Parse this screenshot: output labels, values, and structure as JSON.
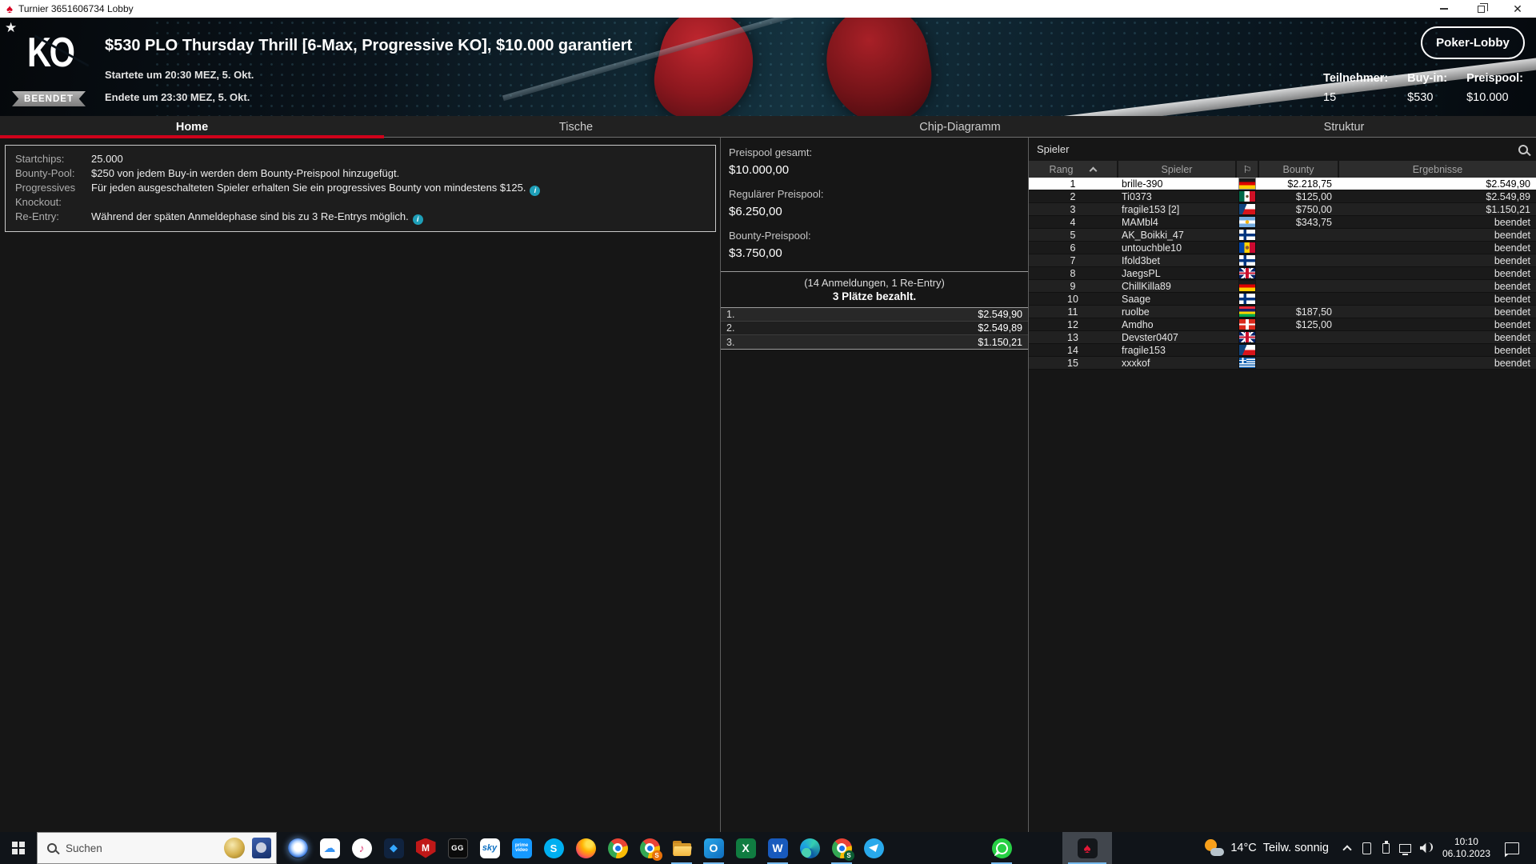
{
  "window": {
    "title": "Turnier 3651606734 Lobby"
  },
  "header": {
    "logo": "KO",
    "status_badge": "BEENDET",
    "title": "$530 PLO Thursday Thrill [6-Max, Progressive KO], $10.000 garantiert",
    "started": "Startete um 20:30 MEZ, 5. Okt.",
    "ended": "Endete um 23:30 MEZ, 5. Okt.",
    "lobby_button": "Poker-Lobby",
    "stats": [
      {
        "label": "Teilnehmer:",
        "value": "15"
      },
      {
        "label": "Buy-in:",
        "value": "$530"
      },
      {
        "label": "Preispool:",
        "value": "$10.000"
      }
    ]
  },
  "tabs": [
    {
      "name": "home",
      "label": "Home",
      "active": true
    },
    {
      "name": "tische",
      "label": "Tische"
    },
    {
      "name": "chip-diagramm",
      "label": "Chip-Diagramm"
    },
    {
      "name": "struktur",
      "label": "Struktur"
    }
  ],
  "info_panel": {
    "rows": [
      {
        "label": "Startchips:",
        "text": "25.000"
      },
      {
        "label": "Bounty-Pool:",
        "text": "$250 von jedem Buy-in werden dem Bounty-Preispool hinzugefügt."
      },
      {
        "label": "Progressives Knockout:",
        "text": "Für jeden ausgeschalteten Spieler erhalten Sie ein progressives Bounty von mindestens $125.",
        "info": true
      },
      {
        "label": "Re-Entry:",
        "text": "Während der späten Anmeldephase sind bis zu 3 Re-Entrys möglich.",
        "info": true
      }
    ]
  },
  "prize_panel": {
    "pools": [
      {
        "label": "Preispool gesamt:",
        "value": "$10.000,00"
      },
      {
        "label": "Regulärer Preispool:",
        "value": "$6.250,00"
      },
      {
        "label": "Bounty-Preispool:",
        "value": "$3.750,00"
      }
    ],
    "entries_note": "(14 Anmeldungen, 1 Re-Entry)",
    "places_paid": "3 Plätze bezahlt.",
    "payouts": [
      {
        "place": "1.",
        "amount": "$2.549,90"
      },
      {
        "place": "2.",
        "amount": "$2.549,89"
      },
      {
        "place": "3.",
        "amount": "$1.150,21"
      }
    ]
  },
  "players_panel": {
    "title": "Spieler",
    "columns": {
      "rank": "Rang",
      "player": "Spieler",
      "bounty": "Bounty",
      "result": "Ergebnisse"
    },
    "rows": [
      {
        "rank": "1",
        "name": "brille-390",
        "flag": "de",
        "bounty": "$2.218,75",
        "result": "$2.549,90",
        "highlight": true
      },
      {
        "rank": "2",
        "name": "Ti0373",
        "flag": "mx",
        "bounty": "$125,00",
        "result": "$2.549,89"
      },
      {
        "rank": "3",
        "name": "fragile153 [2]",
        "flag": "cz",
        "bounty": "$750,00",
        "result": "$1.150,21"
      },
      {
        "rank": "4",
        "name": "MAMbl4",
        "flag": "ar",
        "bounty": "$343,75",
        "result": "beendet"
      },
      {
        "rank": "5",
        "name": "AK_Boikki_47",
        "flag": "fi",
        "bounty": "",
        "result": "beendet"
      },
      {
        "rank": "6",
        "name": "untouchble10",
        "flag": "md",
        "bounty": "",
        "result": "beendet"
      },
      {
        "rank": "7",
        "name": "Ifold3bet",
        "flag": "fi",
        "bounty": "",
        "result": "beendet"
      },
      {
        "rank": "8",
        "name": "JaegsPL",
        "flag": "gb",
        "bounty": "",
        "result": "beendet"
      },
      {
        "rank": "9",
        "name": "ChillKilla89",
        "flag": "de",
        "bounty": "",
        "result": "beendet"
      },
      {
        "rank": "10",
        "name": "Saage",
        "flag": "fi",
        "bounty": "",
        "result": "beendet"
      },
      {
        "rank": "11",
        "name": "ruolbe",
        "flag": "mu",
        "bounty": "$187,50",
        "result": "beendet"
      },
      {
        "rank": "12",
        "name": "Amdho",
        "flag": "ch",
        "bounty": "$125,00",
        "result": "beendet"
      },
      {
        "rank": "13",
        "name": "Devster0407",
        "flag": "gb",
        "bounty": "",
        "result": "beendet"
      },
      {
        "rank": "14",
        "name": "fragile153",
        "flag": "cz",
        "bounty": "",
        "result": "beendet"
      },
      {
        "rank": "15",
        "name": "xxxkof",
        "flag": "gr",
        "bounty": "",
        "result": "beendet"
      }
    ]
  },
  "taskbar": {
    "search_placeholder": "Suchen",
    "apps": [
      {
        "name": "copilot",
        "glyph": ""
      },
      {
        "name": "icloud",
        "glyph": "☁"
      },
      {
        "name": "itunes",
        "glyph": "♪"
      },
      {
        "name": "films",
        "glyph": "◆"
      },
      {
        "name": "mcafee",
        "glyph": "M"
      },
      {
        "name": "ggpoker",
        "glyph": "GG"
      },
      {
        "name": "sky",
        "glyph": "sky"
      },
      {
        "name": "prime-video",
        "glyph": "prime video"
      },
      {
        "name": "skype",
        "glyph": "S"
      },
      {
        "name": "firefox",
        "glyph": ""
      },
      {
        "name": "chrome",
        "glyph": ""
      },
      {
        "name": "chrome-profile2",
        "glyph": "",
        "badge": "S"
      },
      {
        "name": "file-explorer",
        "glyph": "",
        "active": true
      },
      {
        "name": "outlook",
        "glyph": "O",
        "active": true
      },
      {
        "name": "excel",
        "glyph": "X"
      },
      {
        "name": "word",
        "glyph": "W",
        "active": true
      },
      {
        "name": "edge",
        "glyph": ""
      },
      {
        "name": "chrome-profile3",
        "glyph": "",
        "badge": "S",
        "active": true
      },
      {
        "name": "telegram",
        "glyph": ""
      },
      {
        "name": "whatsapp",
        "glyph": "",
        "active": true,
        "gap_before": true
      },
      {
        "name": "pokerstars",
        "glyph": "♠",
        "active": true,
        "highlight": true
      }
    ],
    "weather": {
      "temp": "14°C",
      "condition": "Teilw. sonnig"
    },
    "clock": {
      "time": "10:10",
      "date": "06.10.2023"
    }
  }
}
